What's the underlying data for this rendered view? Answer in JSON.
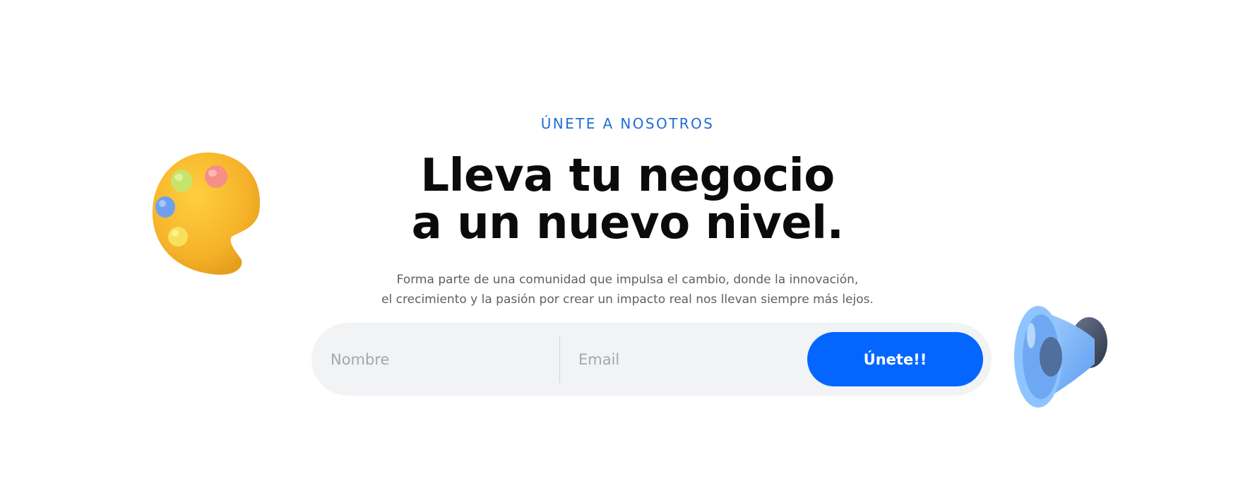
{
  "section": {
    "eyebrow": "ÚNETE A NOSOTROS",
    "headline_line1": "Lleva tu negocio",
    "headline_line2": "a un nuevo nivel.",
    "subtitle_line1": "Forma parte de una comunidad que impulsa el cambio, donde la innovación,",
    "subtitle_line2": "el crecimiento y la pasión por crear un impacto real nos llevan siempre más lejos."
  },
  "form": {
    "name_placeholder": "Nombre",
    "email_placeholder": "Email",
    "submit_label": "Únete!!"
  },
  "colors": {
    "accent": "#0466ff",
    "eyebrow": "#1f6fd1",
    "form_background": "#f2f3f5"
  },
  "icons": {
    "left_decoration": "paint-palette-icon",
    "right_decoration": "megaphone-speaker-icon"
  }
}
